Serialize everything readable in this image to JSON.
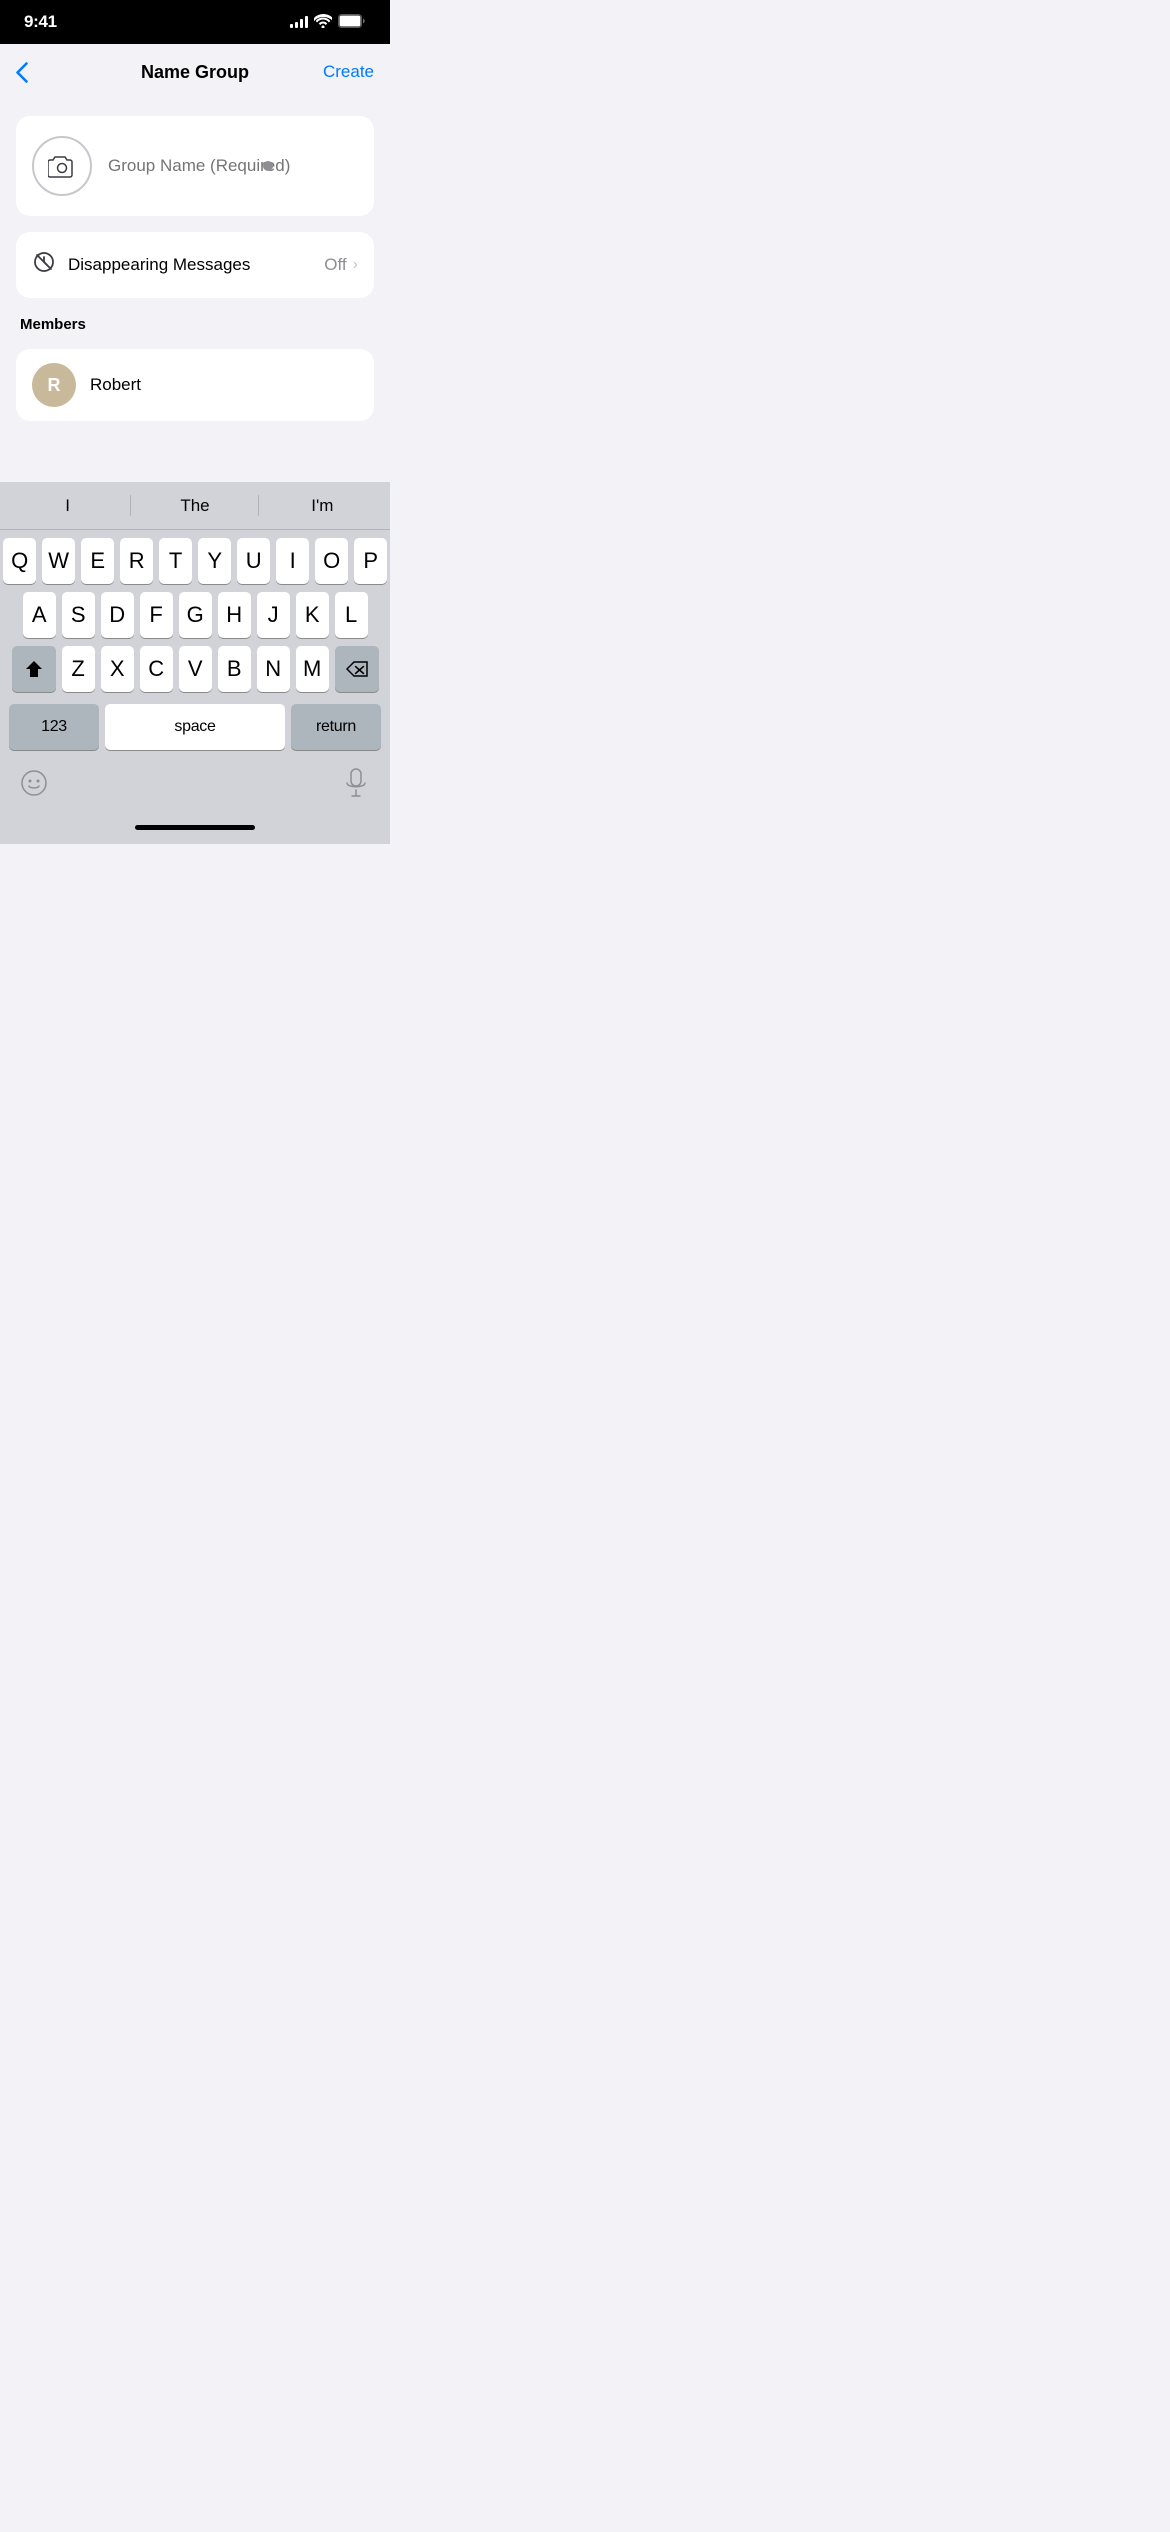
{
  "statusBar": {
    "time": "9:41"
  },
  "navBar": {
    "backLabel": "‹",
    "title": "Name Group",
    "createLabel": "Create"
  },
  "groupNameCard": {
    "inputPlaceholder": "Group Name (Required)"
  },
  "disappearing": {
    "label": "Disappearing Messages",
    "value": "Off"
  },
  "members": {
    "sectionLabel": "Members",
    "list": [
      {
        "initials": "R",
        "name": "Robert"
      }
    ]
  },
  "predictive": {
    "words": [
      "I",
      "The",
      "I'm"
    ]
  },
  "keyboard": {
    "rows": [
      [
        "Q",
        "W",
        "E",
        "R",
        "T",
        "Y",
        "U",
        "I",
        "O",
        "P"
      ],
      [
        "A",
        "S",
        "D",
        "F",
        "G",
        "H",
        "J",
        "K",
        "L"
      ],
      [
        "Z",
        "X",
        "C",
        "V",
        "B",
        "N",
        "M"
      ]
    ],
    "spaceLabel": "space",
    "returnLabel": "return",
    "numbersLabel": "123"
  }
}
